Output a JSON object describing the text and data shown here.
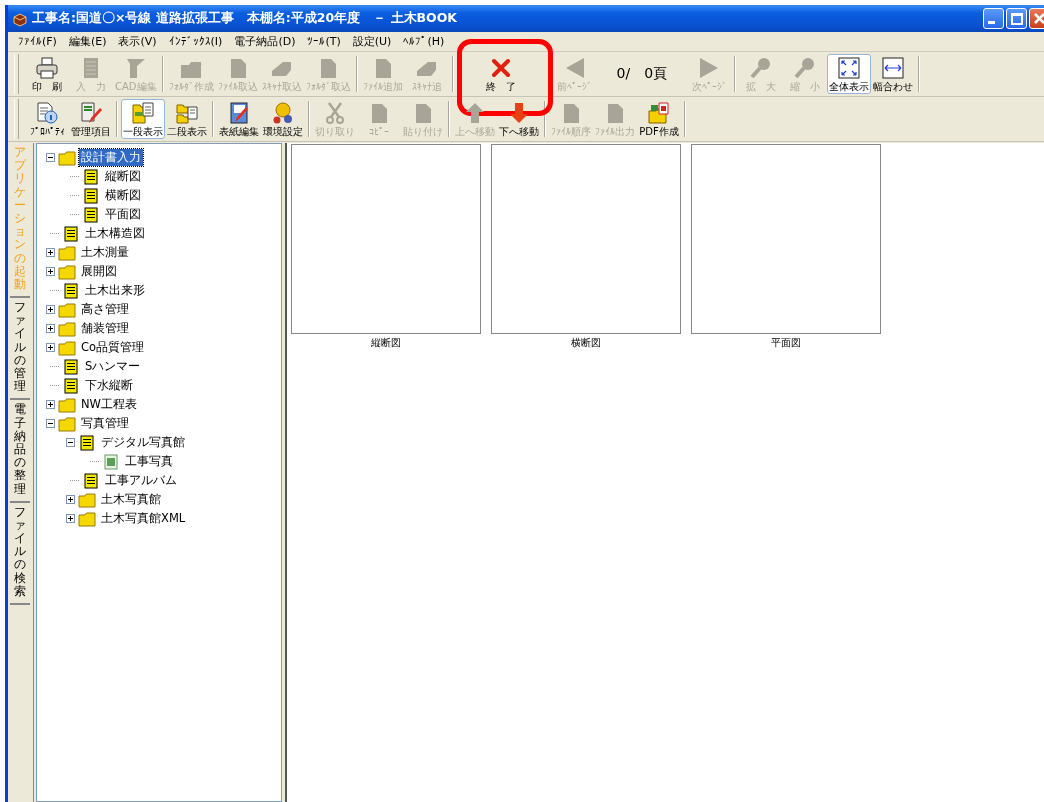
{
  "window": {
    "title": "工事名:国道〇×号線 道路拡張工事　本棚名:平成20年度　－ 土木BOOK"
  },
  "menu": [
    "ﾌｧｲﾙ(F)",
    "編集(E)",
    "表示(V)",
    "ｲﾝﾃﾞｯｸｽ(I)",
    "電子納品(D)",
    "ﾂｰﾙ(T)",
    "設定(U)",
    "ﾍﾙﾌﾟ(H)"
  ],
  "toolbar1": {
    "groups": [
      {
        "items": [
          {
            "kind": "button",
            "label": "印　刷",
            "disabled": false,
            "pressed": false,
            "highlighted": false
          },
          {
            "kind": "button",
            "label": "入　力",
            "disabled": true,
            "pressed": false,
            "highlighted": false
          },
          {
            "kind": "button",
            "label": "CAD編集",
            "disabled": true,
            "pressed": false,
            "highlighted": false
          }
        ]
      },
      {
        "items": [
          {
            "kind": "button",
            "label": "ﾌｫﾙﾀﾞ作成",
            "disabled": true,
            "pressed": false,
            "highlighted": false
          },
          {
            "kind": "button",
            "label": "ﾌｧｲﾙ取込",
            "disabled": true,
            "pressed": false,
            "highlighted": false
          },
          {
            "kind": "button",
            "label": "ｽｷｬﾅ取込",
            "disabled": true,
            "pressed": false,
            "highlighted": false
          },
          {
            "kind": "button",
            "label": "ﾌｫﾙﾀﾞ取込",
            "disabled": true,
            "pressed": false,
            "highlighted": false
          }
        ]
      },
      {
        "items": [
          {
            "kind": "button",
            "label": "ﾌｧｲﾙ追加",
            "disabled": true,
            "pressed": false,
            "highlighted": false
          },
          {
            "kind": "button",
            "label": "ｽｷｬﾅ追",
            "disabled": true,
            "pressed": false,
            "highlighted": false
          }
        ]
      },
      {
        "items": [
          {
            "kind": "button",
            "label": "終　了",
            "disabled": false,
            "pressed": false,
            "highlighted": true
          }
        ]
      },
      {
        "items": [
          {
            "kind": "button",
            "label": "前ﾍﾟｰｼﾞ",
            "disabled": true,
            "pressed": false,
            "highlighted": false
          },
          {
            "kind": "counter",
            "text": "0/　0頁"
          },
          {
            "kind": "button",
            "label": "次ﾍﾟｰｼﾞ",
            "disabled": true,
            "pressed": false,
            "highlighted": false
          }
        ]
      },
      {
        "items": [
          {
            "kind": "button",
            "label": "拡　大",
            "disabled": true,
            "pressed": false,
            "highlighted": false
          },
          {
            "kind": "button",
            "label": "縮　小",
            "disabled": true,
            "pressed": false,
            "highlighted": false
          },
          {
            "kind": "button",
            "label": "全体表示",
            "disabled": false,
            "pressed": true,
            "highlighted": false
          },
          {
            "kind": "button",
            "label": "幅合わせ",
            "disabled": false,
            "pressed": false,
            "highlighted": false
          }
        ]
      }
    ]
  },
  "toolbar2": {
    "groups": [
      {
        "items": [
          {
            "kind": "button",
            "label": "ﾌﾟﾛﾊﾟﾃｨ",
            "disabled": false,
            "pressed": false
          },
          {
            "kind": "button",
            "label": "管理項目",
            "disabled": false,
            "pressed": false
          }
        ]
      },
      {
        "items": [
          {
            "kind": "button",
            "label": "一段表示",
            "disabled": false,
            "pressed": true
          },
          {
            "kind": "button",
            "label": "二段表示",
            "disabled": false,
            "pressed": false
          }
        ]
      },
      {
        "items": [
          {
            "kind": "button",
            "label": "表紙編集",
            "disabled": false,
            "pressed": false
          },
          {
            "kind": "button",
            "label": "環境設定",
            "disabled": false,
            "pressed": false
          }
        ]
      },
      {
        "items": [
          {
            "kind": "button",
            "label": "切り取り",
            "disabled": true,
            "pressed": false
          },
          {
            "kind": "button",
            "label": "ｺﾋﾟｰ",
            "disabled": true,
            "pressed": false
          },
          {
            "kind": "button",
            "label": "貼り付け",
            "disabled": true,
            "pressed": false
          }
        ]
      },
      {
        "items": [
          {
            "kind": "button",
            "label": "上へ移動",
            "disabled": true,
            "pressed": false
          },
          {
            "kind": "button",
            "label": "下へ移動",
            "disabled": false,
            "pressed": false
          }
        ]
      },
      {
        "items": [
          {
            "kind": "button",
            "label": "ﾌｧｲﾙ順序",
            "disabled": true,
            "pressed": false
          },
          {
            "kind": "button",
            "label": "ﾌｧｲﾙ出力",
            "disabled": true,
            "pressed": false
          },
          {
            "kind": "button",
            "label": "PDF作成",
            "disabled": false,
            "pressed": false
          }
        ]
      }
    ]
  },
  "side_tabs": [
    {
      "label": "アプリケーションの起動",
      "selected": true
    },
    {
      "label": "ファイルの管理",
      "selected": false
    },
    {
      "label": "電子納品の整理",
      "selected": false
    },
    {
      "label": "ファイルの検索",
      "selected": false
    }
  ],
  "tree": [
    {
      "label": "設計書入力",
      "kind": "folder",
      "expanded": true,
      "selected": true,
      "children": [
        {
          "label": "縦断図",
          "kind": "document",
          "selected": false
        },
        {
          "label": "横断図",
          "kind": "document",
          "selected": false
        },
        {
          "label": "平面図",
          "kind": "document",
          "selected": false
        }
      ]
    },
    {
      "label": "土木構造図",
      "kind": "document",
      "selected": false
    },
    {
      "label": "土木測量",
      "kind": "folder",
      "expanded": false,
      "selected": false
    },
    {
      "label": "展開図",
      "kind": "folder",
      "expanded": false,
      "selected": false
    },
    {
      "label": "土木出来形",
      "kind": "document",
      "selected": false
    },
    {
      "label": "高さ管理",
      "kind": "folder",
      "expanded": false,
      "selected": false
    },
    {
      "label": "舗装管理",
      "kind": "folder",
      "expanded": false,
      "selected": false
    },
    {
      "label": "Co品質管理",
      "kind": "folder",
      "expanded": false,
      "selected": false
    },
    {
      "label": "Sハンマー",
      "kind": "document",
      "selected": false
    },
    {
      "label": "下水縦断",
      "kind": "document",
      "selected": false
    },
    {
      "label": "NW工程表",
      "kind": "folder",
      "expanded": false,
      "selected": false
    },
    {
      "label": "写真管理",
      "kind": "folder",
      "expanded": true,
      "selected": false,
      "children": [
        {
          "label": "デジタル写真館",
          "kind": "document",
          "expanded": true,
          "selected": false,
          "children": [
            {
              "label": "工事写真",
              "kind": "photo",
              "selected": false
            }
          ]
        },
        {
          "label": "工事アルバム",
          "kind": "document",
          "selected": false
        },
        {
          "label": "土木写真館",
          "kind": "folder",
          "expanded": false,
          "selected": false
        },
        {
          "label": "土木写真館XML",
          "kind": "folder",
          "expanded": false,
          "selected": false
        }
      ]
    }
  ],
  "thumbnails": [
    {
      "caption": "縦断図"
    },
    {
      "caption": "横断図"
    },
    {
      "caption": "平面図"
    }
  ]
}
